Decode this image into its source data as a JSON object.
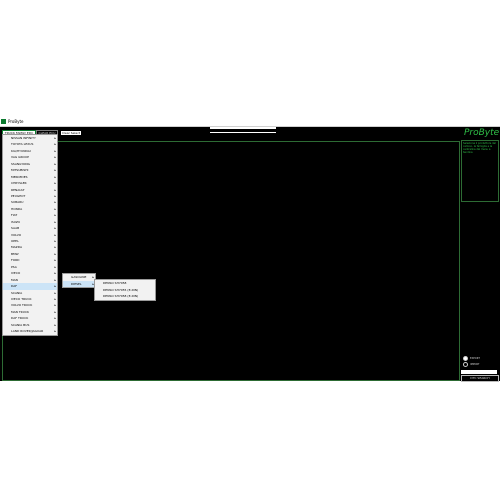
{
  "window": {
    "title": "ProByte"
  },
  "header": {
    "tabs": [
      {
        "label": "TRUCK FAMILY EDC"
      },
      {
        "label": "CLEAR ECU"
      }
    ],
    "clear_button": "Clear Select",
    "logo": "ProByte"
  },
  "side_panel": {
    "text": "Seleziona il produttore del camion, la famiglia e la centralina dal menu a tendina",
    "radio_options": [
      {
        "label": "EXPORT",
        "selected": true
      },
      {
        "label": "IMPORT",
        "selected": false
      }
    ],
    "search_button": "DTC SEARCH"
  },
  "menu_level1": [
    "NISSAN INFINITY",
    "TOYOTA LEXUS",
    "KIA/HYUNDAI",
    "VAG GROUP",
    "SSANGYONG",
    "MITSUBISHI",
    "MERCEDES",
    "CHRYSLER",
    "RENAULT",
    "PEUGEOT",
    "SUBARU",
    "HONDA",
    "FIAT",
    "ISUZU",
    "SAAB",
    "VOLVO",
    "OPEL",
    "MAZDA",
    "BMW",
    "FORD",
    "PSA",
    "IVECO",
    "MAN",
    "DAF",
    "SCANIA",
    "IVECO TRUCK",
    "VOLVO TRUCK",
    "MAN TRUCK",
    "DAF TRUCK",
    "SCANIA BUS",
    "LAND ROVER/JAGUAR"
  ],
  "menu_level1_highlight": 23,
  "menu_level2": [
    "GASOLINE",
    "DIESEL"
  ],
  "menu_level2_highlight": 1,
  "menu_level3": [
    "DENSO SH7058",
    "DENSO SH7055 (E-DIN)",
    "DENSO SH7058 (E-DIN)"
  ],
  "colors": {
    "accent": "#2fbf47",
    "background": "#000000",
    "menu_bg": "#f2f2f2",
    "highlight": "#cce4f7"
  }
}
